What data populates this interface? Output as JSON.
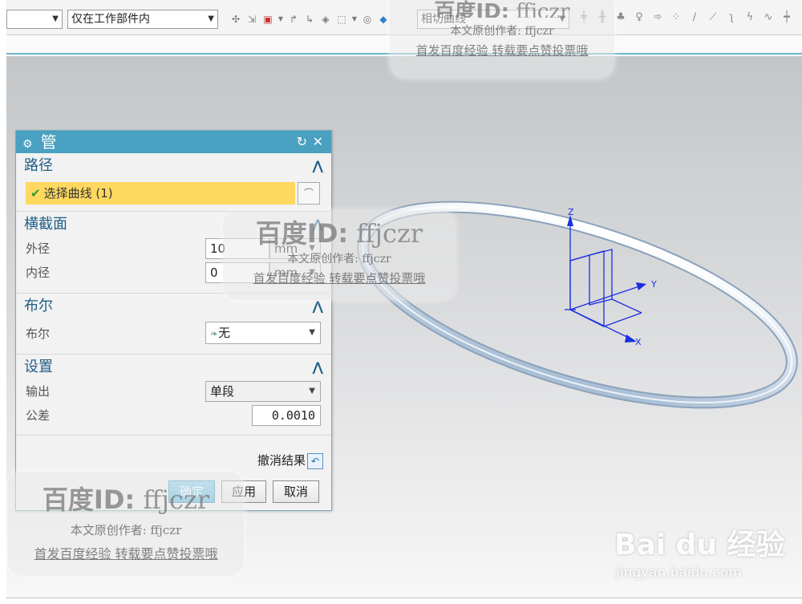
{
  "toolbar": {
    "filter_value": "",
    "scope_value": "仅在工作部件内",
    "curve_rule_value": "相切曲线"
  },
  "dialog": {
    "title": "管",
    "path_section": {
      "label": "路径",
      "select_curve": "选择曲线 (1)"
    },
    "cross_section": {
      "label": "横截面",
      "outer_label": "外径",
      "outer_value": "10",
      "outer_unit": "mm",
      "inner_label": "内径",
      "inner_value": "0",
      "inner_unit": "mm"
    },
    "boolean_section": {
      "label": "布尔",
      "row_label": "布尔",
      "value": "无"
    },
    "settings_section": {
      "label": "设置",
      "output_label": "输出",
      "output_value": "单段",
      "tolerance_label": "公差",
      "tolerance_value": "0.0010"
    },
    "undo_label": "撤消结果",
    "ok_label": "确定",
    "apply_label": "应用",
    "cancel_label": "取消"
  },
  "axes": {
    "z": "Z",
    "y": "Y",
    "x": "X"
  },
  "watermark": {
    "title": "百度ID:",
    "id": "ffjczr",
    "line2": "本文原创作者: ffjczr",
    "line3": "首发百度经验 转载要点赞投票哦"
  },
  "baidu": {
    "logo": "Bai du 经验",
    "url": "jingyan.baidu.com"
  },
  "colors": {
    "title_bar": "#4aa0c0",
    "section_text": "#1f5f86",
    "selected_curve": "#ffd85f",
    "axis": "#1a2fe0"
  }
}
